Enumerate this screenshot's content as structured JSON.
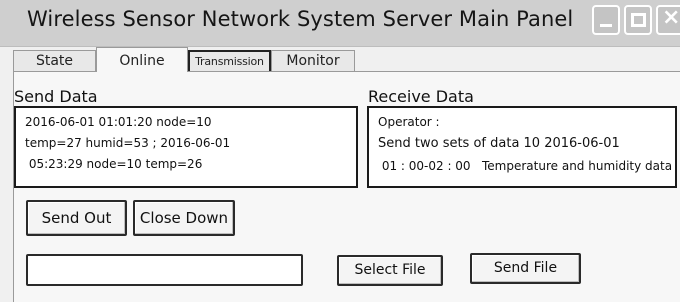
{
  "window": {
    "title": "Wireless Sensor Network System Server Main Panel",
    "controls": {
      "minimize_icon": "minimize-icon",
      "maximize_icon": "maximize-icon",
      "close_icon": "close-icon"
    }
  },
  "tabs": [
    {
      "label": "State"
    },
    {
      "label": "Online",
      "selected": true
    },
    {
      "label": "Transmission"
    },
    {
      "label": "Monitor"
    }
  ],
  "send_data": {
    "label": "Send Data",
    "lines": [
      "2016-06-01 01:01:20 node=10",
      "temp=27 humid=53 ; 2016-06-01",
      " 05:23:29 node=10 temp=26"
    ]
  },
  "receive_data": {
    "label": "Receive Data",
    "lines": [
      "Operator :",
      "Send two sets of data 10 2016-06-01",
      " 01 : 00-02 : 00   Temperature and humidity data"
    ]
  },
  "buttons": {
    "send_out": "Send Out",
    "close_down": "Close Down",
    "select_file": "Select File",
    "send_file": "Send File"
  },
  "file_path": {
    "value": "",
    "placeholder": ""
  }
}
